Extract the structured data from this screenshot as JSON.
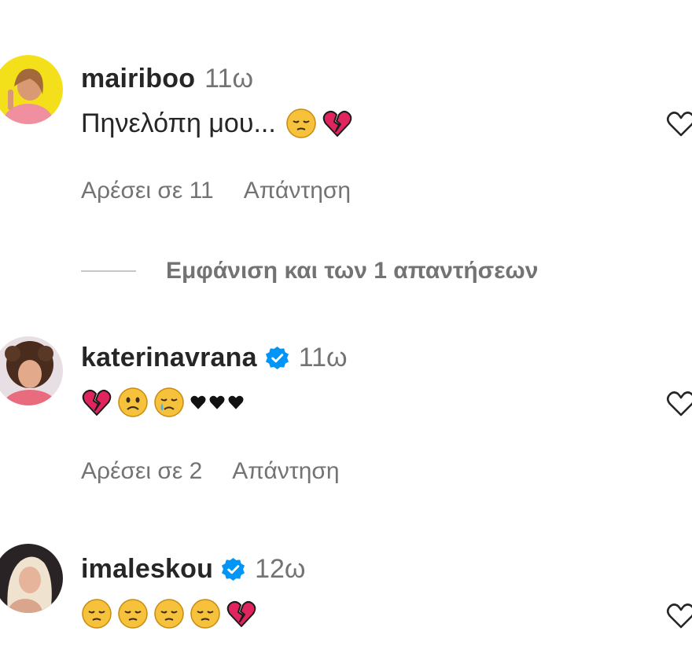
{
  "comments": [
    {
      "username": "mairiboo",
      "verified": false,
      "time": "11ω",
      "text": "Πηνελόπη μου...",
      "emojis": [
        "pensive-face",
        "broken-heart"
      ],
      "likes_label": "Αρέσει σε 11",
      "reply_label": "Απάντηση"
    },
    {
      "username": "katerinavrana",
      "verified": true,
      "time": "11ω",
      "text": "",
      "emojis": [
        "broken-heart",
        "frowning-face",
        "crying-face",
        "black-heart",
        "black-heart",
        "black-heart"
      ],
      "likes_label": "Αρέσει σε 2",
      "reply_label": "Απάντηση"
    },
    {
      "username": "imaleskou",
      "verified": true,
      "time": "12ω",
      "text": "",
      "emojis": [
        "pensive-face",
        "pensive-face",
        "pensive-face",
        "pensive-face",
        "broken-heart"
      ]
    }
  ],
  "view_replies_label": "Εμφάνιση και των 1 απαντήσεων",
  "colors": {
    "text": "#262626",
    "secondary": "#737373",
    "verified": "#0095f6",
    "heart_red": "#e0245e"
  }
}
